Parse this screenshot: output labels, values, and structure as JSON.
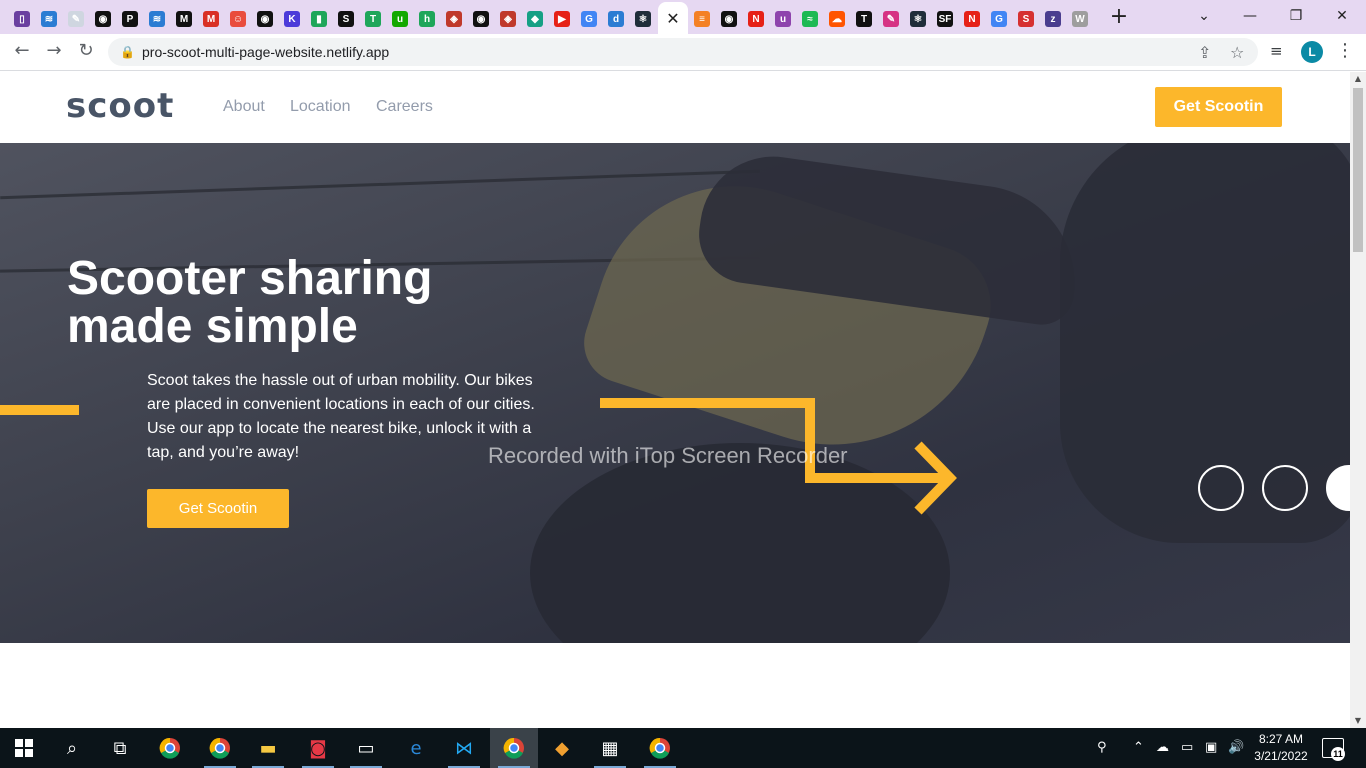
{
  "browser": {
    "tabs": [
      {
        "icon": "notebook-icon",
        "color": "#6a3fa0",
        "glyph": "▯"
      },
      {
        "icon": "ms-icon",
        "color": "#2b7cd3",
        "glyph": "≋"
      },
      {
        "icon": "doc-icon",
        "color": "#cfd6e0",
        "glyph": "✎"
      },
      {
        "icon": "github-icon",
        "color": "#111111",
        "glyph": "◉"
      },
      {
        "icon": "p-icon",
        "color": "#111111",
        "glyph": "P"
      },
      {
        "icon": "ms-icon",
        "color": "#2b7cd3",
        "glyph": "≋"
      },
      {
        "icon": "m-icon",
        "color": "#111111",
        "glyph": "M"
      },
      {
        "icon": "gmail-icon",
        "color": "#d93025",
        "glyph": "M"
      },
      {
        "icon": "smile-icon",
        "color": "#e94c3d",
        "glyph": "☺"
      },
      {
        "icon": "github-icon",
        "color": "#111111",
        "glyph": "◉"
      },
      {
        "icon": "k-icon",
        "color": "#4c3ad9",
        "glyph": "K"
      },
      {
        "icon": "phone-icon",
        "color": "#1ea65a",
        "glyph": "▮"
      },
      {
        "icon": "s-icon",
        "color": "#111111",
        "glyph": "S"
      },
      {
        "icon": "t-icon",
        "color": "#1ea65a",
        "glyph": "T"
      },
      {
        "icon": "up-icon",
        "color": "#14a800",
        "glyph": "u"
      },
      {
        "icon": "h-icon",
        "color": "#1ea65a",
        "glyph": "h"
      },
      {
        "icon": "shield-icon",
        "color": "#c0392b",
        "glyph": "◈"
      },
      {
        "icon": "github-icon",
        "color": "#111111",
        "glyph": "◉"
      },
      {
        "icon": "shield-icon",
        "color": "#c0392b",
        "glyph": "◈"
      },
      {
        "icon": "diamond-icon",
        "color": "#16a085",
        "glyph": "◆"
      },
      {
        "icon": "youtube-icon",
        "color": "#e62117",
        "glyph": "▶"
      },
      {
        "icon": "google-icon",
        "color": "#4285f4",
        "glyph": "G"
      },
      {
        "icon": "dnd-icon",
        "color": "#2b7cd3",
        "glyph": "d"
      },
      {
        "icon": "react-icon",
        "color": "#1f2d3a",
        "glyph": "⚛"
      }
    ],
    "active_tab_close": "✕",
    "tabs_after": [
      {
        "icon": "stack-icon",
        "color": "#f48024",
        "glyph": "≡"
      },
      {
        "icon": "github-icon",
        "color": "#111111",
        "glyph": "◉"
      },
      {
        "icon": "n-icon",
        "color": "#e62117",
        "glyph": "N"
      },
      {
        "icon": "u-icon",
        "color": "#8e44ad",
        "glyph": "u"
      },
      {
        "icon": "spotify-icon",
        "color": "#1db954",
        "glyph": "≈"
      },
      {
        "icon": "soundcloud-icon",
        "color": "#ff5500",
        "glyph": "☁"
      },
      {
        "icon": "t-icon",
        "color": "#111111",
        "glyph": "T"
      },
      {
        "icon": "pen-icon",
        "color": "#d63384",
        "glyph": "✎"
      },
      {
        "icon": "react-icon",
        "color": "#1f2d3a",
        "glyph": "⚛"
      },
      {
        "icon": "sf-icon",
        "color": "#111111",
        "glyph": "SF"
      },
      {
        "icon": "n-icon",
        "color": "#e62117",
        "glyph": "N"
      },
      {
        "icon": "google-icon",
        "color": "#4285f4",
        "glyph": "G"
      },
      {
        "icon": "s-icon",
        "color": "#d63031",
        "glyph": "S"
      },
      {
        "icon": "zoom-icon",
        "color": "#4a3d8f",
        "glyph": "z"
      },
      {
        "icon": "wordpress-icon",
        "color": "#9e9e9e",
        "glyph": "W"
      }
    ],
    "new_tab": "+",
    "tab_search": "⌄",
    "minimize": "—",
    "restore": "❐",
    "close": "✕",
    "url": "pro-scoot-multi-page-website.netlify.app",
    "back": "←",
    "forward": "→",
    "reload": "↻",
    "lock": "🔒",
    "share": "⇪",
    "star": "☆",
    "media": "≡",
    "profile_initial": "L",
    "menu": "⋮"
  },
  "site": {
    "logo": "scoot",
    "nav": [
      "About",
      "Location",
      "Careers"
    ],
    "nav_cta": "Get Scootin",
    "hero_title": "Scooter sharing made simple",
    "hero_text": "Scoot takes the hassle out of urban mobility. Our bikes are placed in convenient locations in each of our cities. Use our app to locate the nearest bike, unlock it with a tap, and you’re away!",
    "hero_cta": "Get Scootin",
    "accent": "#fcb72b"
  },
  "overlay": {
    "watermark": "Recorded with iTop Screen Recorder"
  },
  "taskbar": {
    "clock_time": "8:27 AM",
    "clock_date": "3/21/2022",
    "notification_count": "11"
  }
}
